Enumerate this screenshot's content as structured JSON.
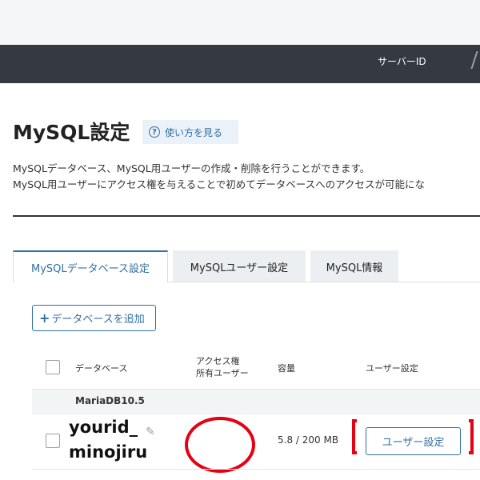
{
  "header": {
    "server_id_label": "サーバーID"
  },
  "page": {
    "title": "MySQL設定",
    "howto_label": "使い方を見る",
    "description": [
      "MySQLデータベース、MySQL用ユーザーの作成・削除を行うことができます。",
      "MySQL用ユーザーにアクセス権を与えることで初めてデータベースへのアクセスが可能にな"
    ]
  },
  "tabs": [
    {
      "label": "MySQLデータベース設定",
      "active": true
    },
    {
      "label": "MySQLユーザー設定",
      "active": false
    },
    {
      "label": "MySQL情報",
      "active": false
    }
  ],
  "add_database_button": "データベースを追加",
  "table": {
    "headers": {
      "database": "データベース",
      "access_line1": "アクセス権",
      "access_line2": "所有ユーザー",
      "capacity": "容量",
      "user_settings": "ユーザー設定"
    },
    "group_label": "MariaDB10.5",
    "rows": [
      {
        "name_line1": "yourid_",
        "name_line2": "minojiru",
        "capacity": "5.8 / 200 MB",
        "user_settings_button": "ユーザー設定"
      }
    ]
  },
  "colors": {
    "accent": "#2f6fa5",
    "annotation_red": "#e60012",
    "header_bar": "#343a40"
  },
  "icons": {
    "howto": "question-circle-icon",
    "add": "plus-icon",
    "edit": "pencil-icon"
  }
}
